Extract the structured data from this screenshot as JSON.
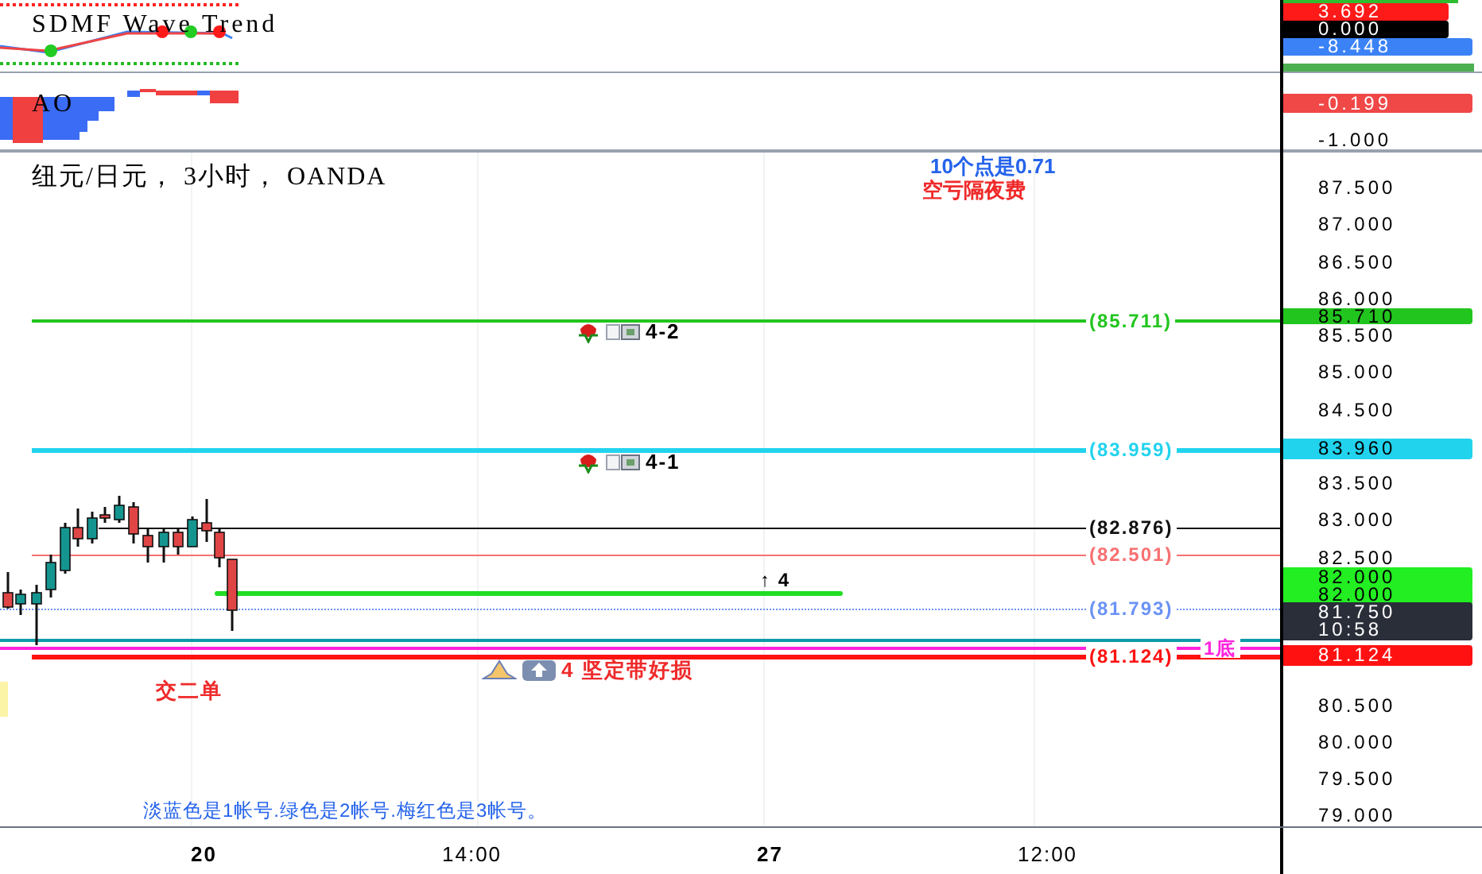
{
  "panes": [
    {
      "title": "SDMF Wave Trend",
      "axis_tags": [
        {
          "text": "3.692",
          "color": "#ff1a1a"
        },
        {
          "text": "0.000",
          "color": "#000000"
        },
        {
          "text": "-8.448",
          "color": "#3b82f6"
        }
      ]
    },
    {
      "title": "AO",
      "axis_tags": [
        {
          "text": "-0.199",
          "color": "#f04747"
        }
      ],
      "axis_ticks": [
        "-1.000"
      ]
    }
  ],
  "main": {
    "title": "纽元/日元， 3小时， OANDA",
    "info": [
      {
        "text": "10个点是0.71",
        "color": "#2563eb"
      },
      {
        "text": "空亏隔夜费",
        "color": "#ef2b2b"
      }
    ],
    "lines": [
      {
        "color": "#22c51e",
        "label": "(85.711)"
      },
      {
        "color": "#22d3ee",
        "label": "(83.959)"
      },
      {
        "color": "#111111",
        "label": "(82.876)"
      },
      {
        "color": "#f87171",
        "label": "(82.501)"
      },
      {
        "color": "#22dd22",
        "label": "↑ 4"
      },
      {
        "color": "#6b93f5",
        "label": "(81.793)"
      },
      {
        "color": "#0e9aa7"
      },
      {
        "color": "#ff22dd",
        "label": "1底"
      },
      {
        "color": "#ff1111",
        "label": "(81.124)"
      }
    ],
    "notes": [
      {
        "kind": "flag",
        "text": "4-2"
      },
      {
        "kind": "flag",
        "text": "4-1"
      },
      {
        "kind": "pray",
        "text": "4  坚定带好损"
      },
      {
        "kind": "plain",
        "text": "交二单"
      }
    ],
    "legend": "淡蓝色是1帐号.绿色是2帐号.梅红色是3帐号。",
    "axis_ticks": [
      "87.500",
      "87.000",
      "86.500",
      "86.000",
      "85.500",
      "85.000",
      "84.500",
      "83.500",
      "83.000",
      "82.500",
      "80.500",
      "80.000",
      "79.500",
      "79.000"
    ],
    "axis_tags": [
      {
        "text": "85.710",
        "color": "#22c51e"
      },
      {
        "text": "83.960",
        "color": "#22d3ee"
      },
      {
        "text": "82.000",
        "color": "#22ee22"
      },
      {
        "text": "82.000",
        "color": "#22ee22"
      },
      {
        "text": "81.750",
        "sub": "10:58",
        "color": "#2a2e39"
      },
      {
        "text": "81.124",
        "color": "#ff1111"
      }
    ]
  },
  "time_axis": [
    {
      "kind": "day",
      "text": "20"
    },
    {
      "kind": "time",
      "text": "14:00"
    },
    {
      "kind": "day",
      "text": "27"
    },
    {
      "kind": "time",
      "text": "12:00"
    }
  ]
}
